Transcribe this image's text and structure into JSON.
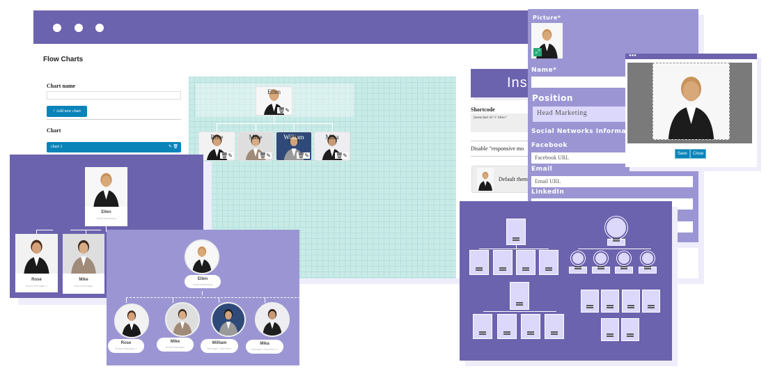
{
  "window": {
    "title": "Flow Charts",
    "dots": 3
  },
  "sidebar": {
    "chart_name_label": "Chart name",
    "chart_name_value": "",
    "add_button": "+ Add new chart",
    "chart_label": "Chart",
    "charts": [
      {
        "name": "chart 1"
      }
    ]
  },
  "editor": {
    "nodes": [
      {
        "name": "Ellen"
      },
      {
        "name": "Rose"
      },
      {
        "name": "Mike"
      },
      {
        "name": "William"
      },
      {
        "name": "Mika"
      }
    ]
  },
  "info": {
    "header": "Ins",
    "shortcode_label": "Shortcode",
    "shortcode": "[teamchart id='1' titles='",
    "disable_label": "Disable \"responsive mo",
    "theme_label": "Default them"
  },
  "form": {
    "picture_label": "Picture*",
    "name_label": "Name*",
    "name_value": "",
    "position_label": "Position",
    "position_value": "Head Marketing",
    "social_label": "Social Networks Informati",
    "facebook_label": "Facebook",
    "facebook_placeholder": "Facebook URL",
    "email_label": "Email",
    "email_placeholder": "Email URL",
    "linkedin_label": "LinkedIn"
  },
  "crop": {
    "save": "Save",
    "close": "Close"
  },
  "chart_card": {
    "root": {
      "name": "Ellen",
      "position": "Head Marketing"
    },
    "children": [
      {
        "name": "Rose",
        "position": "Brand Manager 2"
      },
      {
        "name": "Mike",
        "position": "Brand Manager"
      }
    ]
  },
  "circle_card": {
    "root": {
      "name": "Ellen",
      "position": "Head Marketing"
    },
    "children": [
      {
        "name": "Rose",
        "position": "Brand Manager 2"
      },
      {
        "name": "Mike",
        "position": "Brand Manager"
      },
      {
        "name": "William",
        "position": "Manager Operation"
      },
      {
        "name": "Mika",
        "position": "Manager Operation 3"
      }
    ]
  },
  "colors": {
    "primary": "#6b63ae",
    "secondary": "#9b96d3",
    "button": "#0a84b8",
    "canvas": "#c8ebe8",
    "node_fill": "#dcd8fb"
  }
}
